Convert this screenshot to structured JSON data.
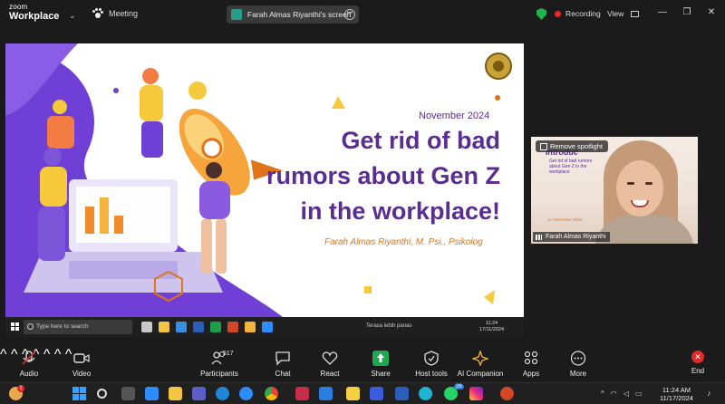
{
  "app": {
    "brand_line1": "zoom",
    "brand_line2": "Workplace"
  },
  "topbar": {
    "meeting_label": "Meeting",
    "share_label": "Farah Almas Riyanthi's screen",
    "recording_label": "Recording",
    "view_label": "View",
    "colors": {
      "recording": "#e02929",
      "secure": "#22b14c"
    }
  },
  "slide": {
    "date": "November 2024",
    "title_line1": "Get rid of bad",
    "title_line2": "rumors about Gen Z",
    "title_line3": "in the workplace!",
    "author": "Farah Almas Riyanthi, M. Psi., Psikolog",
    "colors": {
      "purple": "#5a2d90",
      "orange": "#e0741b",
      "blob": "#6f3fd6"
    },
    "taskbar": {
      "search_placeholder": "Type here to search",
      "weather": "Terasa lebih panas",
      "time": "11:24",
      "date": "17/11/2024"
    }
  },
  "speaker_tile": {
    "spotlight_label": "Remove spotlight",
    "name": "Farah Almas Riyanthi",
    "slide_text_1": "Introduc",
    "slide_text_2": "Get rid of bad rumors about Gen Z in the workplace",
    "slide_text_3": "17 November 2024"
  },
  "toolbar": {
    "audio": "Audio",
    "video": "Video",
    "participants": "Participants",
    "participant_count": "517",
    "chat": "Chat",
    "react": "React",
    "share": "Share",
    "host_tools": "Host tools",
    "ai_companion": "AI Companion",
    "apps": "Apps",
    "more": "More",
    "end": "End"
  },
  "taskbar": {
    "time": "11:24 AM",
    "date": "11/17/2024",
    "whatsapp_badge": "26",
    "notification_badge": "1"
  }
}
